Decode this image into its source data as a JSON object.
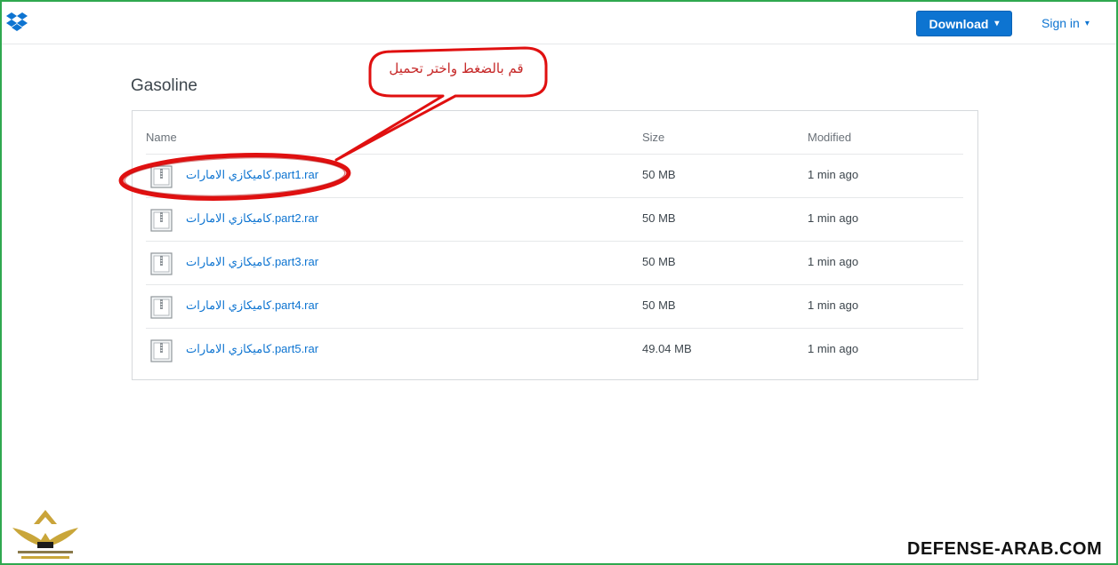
{
  "header": {
    "logo_icon": "dropbox-logo-icon",
    "download_label": "Download",
    "download_caret": "▾",
    "signin_label": "Sign in",
    "signin_caret": "▾",
    "brand_color": "#0d74d1"
  },
  "folder": {
    "title": "Gasoline"
  },
  "table": {
    "columns": {
      "name": "Name",
      "size": "Size",
      "modified": "Modified"
    },
    "rows": [
      {
        "name": "كاميكازي الامارات.part1.rar",
        "size": "50 MB",
        "modified": "1 min ago"
      },
      {
        "name": "كاميكازي الامارات.part2.rar",
        "size": "50 MB",
        "modified": "1 min ago"
      },
      {
        "name": "كاميكازي الامارات.part3.rar",
        "size": "50 MB",
        "modified": "1 min ago"
      },
      {
        "name": "كاميكازي الامارات.part4.rar",
        "size": "50 MB",
        "modified": "1 min ago"
      },
      {
        "name": "كاميكازي الامارات.part5.rar",
        "size": "49.04 MB",
        "modified": "1 min ago"
      }
    ]
  },
  "annotation": {
    "callout_text": "قم بالضغط واختر تحميل",
    "color": "#e01010"
  },
  "watermark": {
    "text": "DEFENSE-ARAB.COM",
    "forum_logo": "arab-defense-forum-logo"
  }
}
